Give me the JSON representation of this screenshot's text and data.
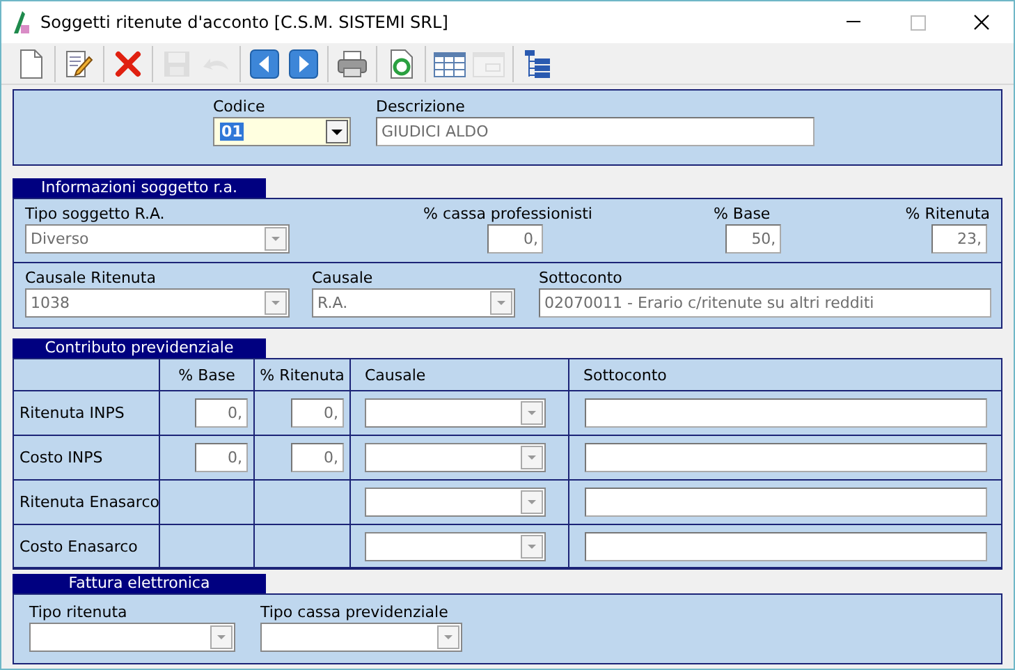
{
  "window": {
    "title": "Soggetti ritenute d'acconto [C.S.M. SISTEMI SRL]"
  },
  "toolbar": [
    [
      {
        "kind": "new",
        "disabled": false
      }
    ],
    [
      {
        "kind": "edit",
        "disabled": false
      }
    ],
    [
      {
        "kind": "delete",
        "disabled": false
      }
    ],
    [
      {
        "kind": "save",
        "disabled": true
      },
      {
        "kind": "undo",
        "disabled": true
      }
    ],
    [
      {
        "kind": "prev",
        "disabled": false
      },
      {
        "kind": "next",
        "disabled": false
      }
    ],
    [
      {
        "kind": "print",
        "disabled": false
      }
    ],
    [
      {
        "kind": "refresh",
        "disabled": false
      }
    ],
    [
      {
        "kind": "grid",
        "disabled": false
      },
      {
        "kind": "form",
        "disabled": true
      }
    ],
    [
      {
        "kind": "tree",
        "disabled": false
      }
    ]
  ],
  "header": {
    "codice": {
      "label": "Codice",
      "value": "01"
    },
    "descrizione": {
      "label": "Descrizione",
      "value": "GIUDICI ALDO"
    }
  },
  "informazioni": {
    "title": "Informazioni soggetto r.a.",
    "tipo_soggetto": {
      "label": "Tipo soggetto R.A.",
      "value": "Diverso"
    },
    "cassa_professionisti": {
      "label": "% cassa professionisti",
      "value": "0,"
    },
    "base": {
      "label": "% Base",
      "value": "50,"
    },
    "ritenuta": {
      "label": "% Ritenuta",
      "value": "23,"
    },
    "causale_ritenuta": {
      "label": "Causale Ritenuta",
      "value": "1038"
    },
    "causale": {
      "label": "Causale",
      "value": "R.A."
    },
    "sottoconto": {
      "label": "Sottoconto",
      "value": "02070011 - Erario c/ritenute su altri redditi"
    }
  },
  "contributo": {
    "title": "Contributo previdenziale",
    "columns": [
      "% Base",
      "% Ritenuta",
      "Causale",
      "Sottoconto"
    ],
    "rows": [
      {
        "label": "Ritenuta INPS",
        "base": "0,",
        "ritenuta": "0,"
      },
      {
        "label": "Costo INPS",
        "base": "0,",
        "ritenuta": "0,"
      },
      {
        "label": "Ritenuta Enasarco"
      },
      {
        "label": "Costo Enasarco"
      }
    ]
  },
  "fattura": {
    "title": "Fattura elettronica",
    "tipo_ritenuta": {
      "label": "Tipo ritenuta"
    },
    "tipo_cassa": {
      "label": "Tipo cassa previdenziale"
    }
  }
}
